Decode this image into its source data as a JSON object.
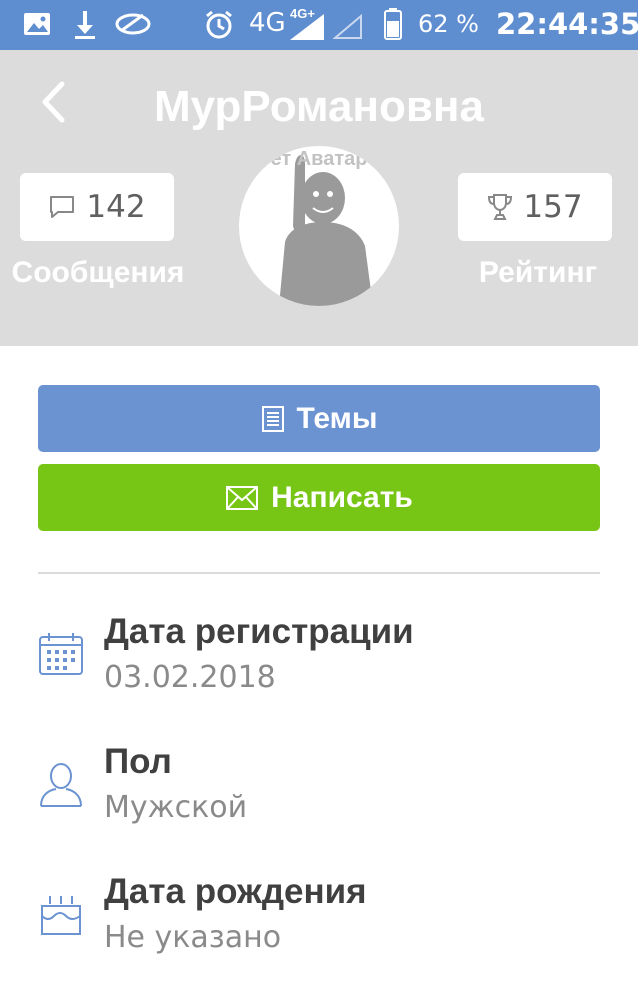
{
  "status_bar": {
    "network": "4G",
    "network_small": "4G+",
    "battery": "62 %",
    "time": "22:44:35",
    "icons": [
      "image-icon",
      "download-icon",
      "sync-icon",
      "alarm-icon",
      "signal-icon",
      "battery-icon"
    ]
  },
  "header": {
    "title": "МурРомановна",
    "messages_count": "142",
    "messages_label": "Сообщения",
    "rating_count": "157",
    "rating_label": "Рейтинг",
    "avatar_text": "ет Аватар"
  },
  "actions": {
    "topics_label": "Темы",
    "write_label": "Написать"
  },
  "info": {
    "registration_label": "Дата регистрации",
    "registration_value": "03.02.2018",
    "gender_label": "Пол",
    "gender_value": "Мужской",
    "birthday_label": "Дата рождения",
    "birthday_value": "Не указано"
  },
  "colors": {
    "status_bar": "#5f8ed0",
    "header_bg": "#dcdcdc",
    "topics_button": "#6b93d2",
    "write_button": "#77c514",
    "icon_blue": "#6b93d2"
  }
}
